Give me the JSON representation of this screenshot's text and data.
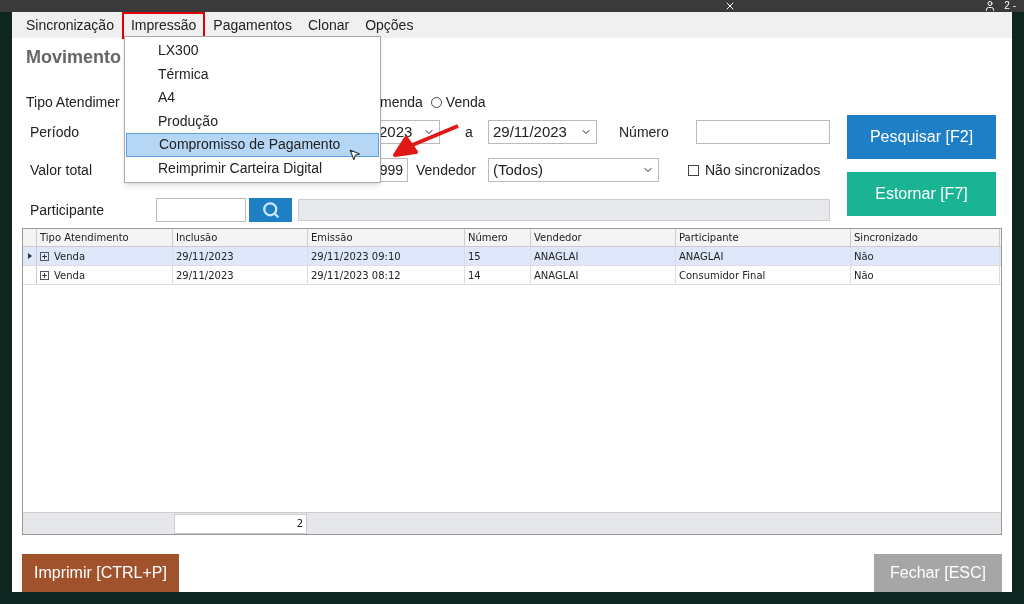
{
  "top_strip": {
    "user_text": "2 -"
  },
  "menu_bar": [
    {
      "label": "Sincronização",
      "selected": false
    },
    {
      "label": "Impressão",
      "selected": true
    },
    {
      "label": "Pagamentos",
      "selected": false
    },
    {
      "label": "Clonar",
      "selected": false
    },
    {
      "label": "Opções",
      "selected": false
    }
  ],
  "dropdown": [
    {
      "label": "LX300",
      "selected": false
    },
    {
      "label": "Térmica",
      "selected": false
    },
    {
      "label": "A4",
      "selected": false
    },
    {
      "label": "Produção",
      "selected": false
    },
    {
      "label": "Compromisso de Pagamento",
      "selected": true
    },
    {
      "label": "Reimprimir Carteira Digital",
      "selected": false
    }
  ],
  "title": "Movimento",
  "tipo_row": {
    "label": "Tipo Atendimer",
    "fragment": "menda",
    "radio": {
      "label": "Venda",
      "selected": false
    }
  },
  "periodo_row": {
    "label": "Período",
    "date_from": "2023",
    "separator": "a",
    "date_to": "29/11/2023",
    "numero_label": "Número"
  },
  "valor_row": {
    "label": "Valor total",
    "value": "999",
    "vendedor_label": "Vendedor",
    "vendedor_value": "(Todos)",
    "checkbox": {
      "label": "Não sincronizados",
      "checked": false
    }
  },
  "participante_row": {
    "label": "Participante"
  },
  "buttons_right": [
    "Pesquisar [F2]",
    "Estornar [F7]"
  ],
  "table": {
    "columns": [
      "Tipo Atendimento",
      "Inclusão",
      "Emissão",
      "Número",
      "Vendedor",
      "Participante",
      "Sincronizado"
    ],
    "rows": [
      {
        "selected": true,
        "cells": [
          "Venda",
          "29/11/2023",
          "29/11/2023 09:10",
          "15",
          "ANAGLAI",
          "ANAGLAI",
          "Não"
        ]
      },
      {
        "selected": false,
        "cells": [
          "Venda",
          "29/11/2023",
          "29/11/2023 08:12",
          "14",
          "ANAGLAI",
          "Consumidor Final",
          "Não"
        ]
      }
    ],
    "footer_count": "2"
  },
  "buttons_bottom": [
    "Imprimir [CTRL+P]",
    "Fechar [ESC]"
  ]
}
